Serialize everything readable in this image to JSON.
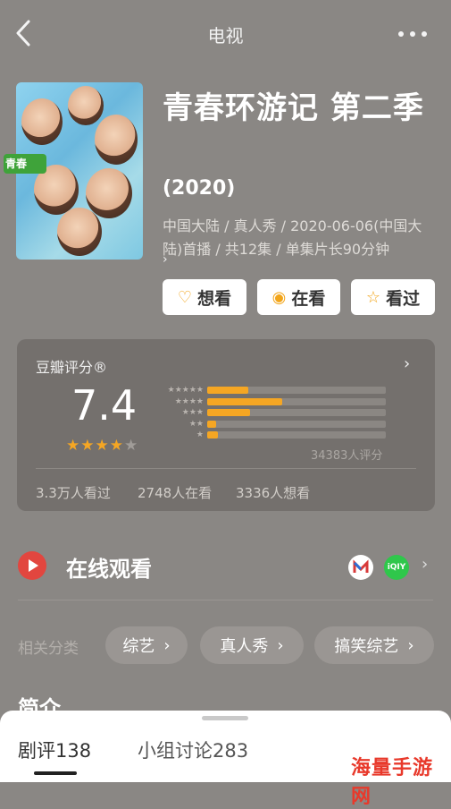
{
  "header": {
    "title": "电视"
  },
  "show": {
    "title": "青春环游记 第二季",
    "year": "(2020)",
    "meta": "中国大陆 / 真人秀 / 2020-06-06(中国大陆)首播 / 共12集 / 单集片长90分钟"
  },
  "poster": {
    "logo_text": "青春"
  },
  "actions": [
    {
      "label": "想看",
      "icon": "heart-icon"
    },
    {
      "label": "在看",
      "icon": "target-icon"
    },
    {
      "label": "看过",
      "icon": "star-icon"
    }
  ],
  "rating": {
    "label": "豆瓣评分®",
    "score": "7.4",
    "stars_filled": 3.5,
    "distribution": [
      {
        "stars": "★★★★★",
        "fraction": 0.23
      },
      {
        "stars": "★★★★",
        "fraction": 0.42
      },
      {
        "stars": "★★★",
        "fraction": 0.24
      },
      {
        "stars": "★★",
        "fraction": 0.05
      },
      {
        "stars": "★",
        "fraction": 0.06
      }
    ],
    "count": "34383人评分",
    "watched": "3.3万人看过",
    "watching": "2748人在看",
    "want": "3336人想看",
    "bar_color": "#f5a623"
  },
  "online": {
    "title": "在线观看",
    "platform2": "iQIY"
  },
  "categories": {
    "label": "相关分类",
    "items": [
      "综艺",
      "真人秀",
      "搞笑综艺"
    ]
  },
  "intro": {
    "title": "简介"
  },
  "bottom_tabs": [
    {
      "label": "剧评138"
    },
    {
      "label": "小组讨论283"
    }
  ],
  "watermark": "海量手游网"
}
